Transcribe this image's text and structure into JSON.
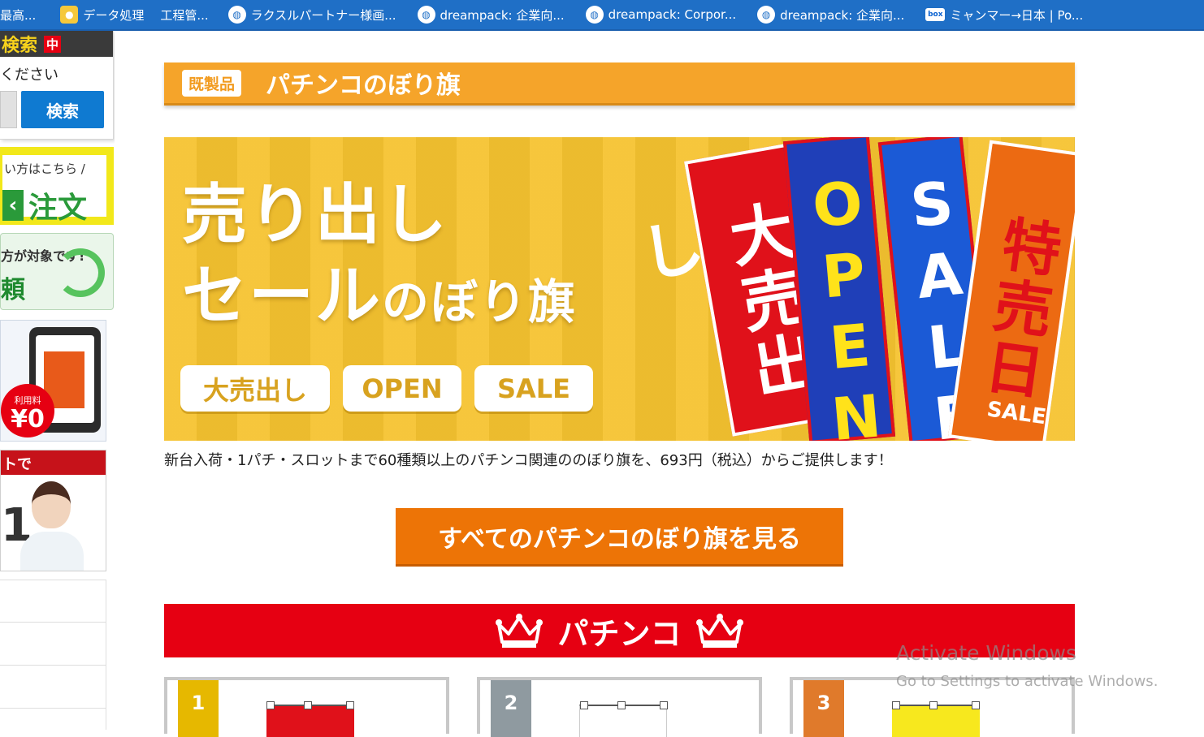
{
  "bookmarks": [
    {
      "label": "最高...",
      "icon": "none"
    },
    {
      "label": "データ処理",
      "icon": "bulb-icon"
    },
    {
      "label": "工程管...",
      "icon": "none"
    },
    {
      "label": "ラクスルパートナー様画...",
      "icon": "globe-icon"
    },
    {
      "label": "dreampack: 企業向...",
      "icon": "globe-icon"
    },
    {
      "label": "dreampack: Corpor...",
      "icon": "globe-icon"
    },
    {
      "label": "dreampack: 企業向...",
      "icon": "globe-icon"
    },
    {
      "label": "ミャンマー→日本 | Po...",
      "icon": "box-icon"
    }
  ],
  "sidebar": {
    "search_heading": "検索",
    "search_badge": "中",
    "search_sub": "ください",
    "search_button": "検索",
    "banner1_text": "い方はこちら /",
    "banner1_big": "注文",
    "banner2_text": "方が対象です!",
    "banner2_big": "頼",
    "banner3_fee_label": "利用料",
    "banner3_fee_value": "¥0",
    "banner4_top": "トで",
    "banner4_big": "1"
  },
  "main": {
    "title_badge": "既製品",
    "title": "パチンコのぼり旗",
    "hero_line1": "売り出し",
    "hero_line2a": "セール",
    "hero_line2b": "のぼり旗",
    "hero_pills": [
      "大売出し",
      "OPEN",
      "SALE"
    ],
    "flags": [
      "大売出し",
      "OPEN",
      "SALE",
      "特売日"
    ],
    "flag_sale_small": "SALE",
    "description": "新台入荷・1パチ・スロットまで60種類以上のパチンコ関連ののぼり旗を、693円（税込）からご提供します！",
    "cta_label": "すべてのパチンコのぼり旗を見る",
    "ranking_title": "パチンコ",
    "ranks": [
      "1",
      "2",
      "3"
    ]
  },
  "colors": {
    "bookmark_bar": "#1f6fc6",
    "title_bar": "#f5a42a",
    "hero_bg": "#f6c330",
    "cta": "#ed7406",
    "ranking": "#e60012"
  },
  "watermark": {
    "line1": "Activate Windows",
    "line2": "Go to Settings to activate Windows."
  }
}
